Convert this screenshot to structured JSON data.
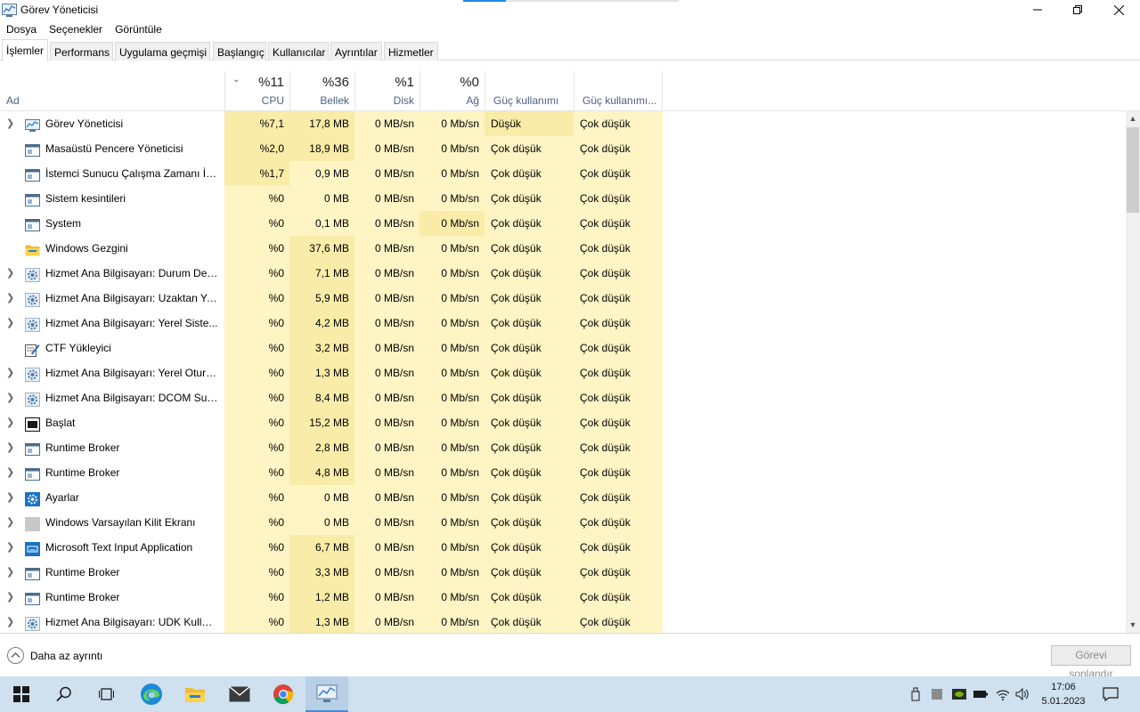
{
  "window": {
    "title": "Görev Yöneticisi"
  },
  "menu": [
    "Dosya",
    "Seçenekler",
    "Görüntüle"
  ],
  "tabs": [
    "İşlemler",
    "Performans",
    "Uygulama geçmişi",
    "Başlangıç",
    "Kullanıcılar",
    "Ayrıntılar",
    "Hizmetler"
  ],
  "columns": {
    "name": "Ad",
    "cpu": {
      "pct": "%11",
      "label": "CPU"
    },
    "memory": {
      "pct": "%36",
      "label": "Bellek"
    },
    "disk": {
      "pct": "%1",
      "label": "Disk"
    },
    "network": {
      "pct": "%0",
      "label": "Ağ"
    },
    "power": "Güç kullanımı",
    "power_trend": "Güç kullanımı..."
  },
  "processes": [
    {
      "name": "Görev Yöneticisi",
      "expand": true,
      "icon": "task-manager-icon",
      "cpu": "%7,1",
      "mem": "17,8 MB",
      "disk": "0 MB/sn",
      "net": "0 Mb/sn",
      "power": "Düşük",
      "trend": "Çok düşük"
    },
    {
      "name": "Masaüstü Pencere Yöneticisi",
      "expand": false,
      "icon": "window-app-icon",
      "cpu": "%2,0",
      "mem": "18,9 MB",
      "disk": "0 MB/sn",
      "net": "0 Mb/sn",
      "power": "Çok düşük",
      "trend": "Çok düşük"
    },
    {
      "name": "İstemci Sunucu Çalışma Zamanı İşl...",
      "expand": false,
      "icon": "window-app-icon",
      "cpu": "%1,7",
      "mem": "0,9 MB",
      "disk": "0 MB/sn",
      "net": "0 Mb/sn",
      "power": "Çok düşük",
      "trend": "Çok düşük"
    },
    {
      "name": "Sistem kesintileri",
      "expand": false,
      "icon": "window-app-icon",
      "cpu": "%0",
      "mem": "0 MB",
      "disk": "0 MB/sn",
      "net": "0 Mb/sn",
      "power": "Çok düşük",
      "trend": "Çok düşük"
    },
    {
      "name": "System",
      "expand": false,
      "icon": "window-app-icon",
      "cpu": "%0",
      "mem": "0,1 MB",
      "disk": "0 MB/sn",
      "net": "0 Mb/sn",
      "power": "Çok düşük",
      "trend": "Çok düşük"
    },
    {
      "name": "Windows Gezgini",
      "expand": false,
      "icon": "folder-icon",
      "cpu": "%0",
      "mem": "37,6 MB",
      "disk": "0 MB/sn",
      "net": "0 Mb/sn",
      "power": "Çok düşük",
      "trend": "Çok düşük"
    },
    {
      "name": "Hizmet Ana Bilgisayarı: Durum Dep...",
      "expand": true,
      "icon": "gear-icon",
      "cpu": "%0",
      "mem": "7,1 MB",
      "disk": "0 MB/sn",
      "net": "0 Mb/sn",
      "power": "Çok düşük",
      "trend": "Çok düşük"
    },
    {
      "name": "Hizmet Ana Bilgisayarı: Uzaktan Yo...",
      "expand": true,
      "icon": "gear-icon",
      "cpu": "%0",
      "mem": "5,9 MB",
      "disk": "0 MB/sn",
      "net": "0 Mb/sn",
      "power": "Çok düşük",
      "trend": "Çok düşük"
    },
    {
      "name": "Hizmet Ana Bilgisayarı: Yerel Siste...",
      "expand": true,
      "icon": "gear-icon",
      "cpu": "%0",
      "mem": "4,2 MB",
      "disk": "0 MB/sn",
      "net": "0 Mb/sn",
      "power": "Çok düşük",
      "trend": "Çok düşük"
    },
    {
      "name": "CTF Yükleyici",
      "expand": false,
      "icon": "pen-icon",
      "cpu": "%0",
      "mem": "3,2 MB",
      "disk": "0 MB/sn",
      "net": "0 Mb/sn",
      "power": "Çok düşük",
      "trend": "Çok düşük"
    },
    {
      "name": "Hizmet Ana Bilgisayarı: Yerel Oturu...",
      "expand": true,
      "icon": "gear-icon",
      "cpu": "%0",
      "mem": "1,3 MB",
      "disk": "0 MB/sn",
      "net": "0 Mb/sn",
      "power": "Çok düşük",
      "trend": "Çok düşük"
    },
    {
      "name": "Hizmet Ana Bilgisayarı: DCOM Sun...",
      "expand": true,
      "icon": "gear-icon",
      "cpu": "%0",
      "mem": "8,4 MB",
      "disk": "0 MB/sn",
      "net": "0 Mb/sn",
      "power": "Çok düşük",
      "trend": "Çok düşük"
    },
    {
      "name": "Başlat",
      "expand": true,
      "icon": "start-app-icon",
      "cpu": "%0",
      "mem": "15,2 MB",
      "disk": "0 MB/sn",
      "net": "0 Mb/sn",
      "power": "Çok düşük",
      "trend": "Çok düşük"
    },
    {
      "name": "Runtime Broker",
      "expand": true,
      "icon": "window-app-icon",
      "cpu": "%0",
      "mem": "2,8 MB",
      "disk": "0 MB/sn",
      "net": "0 Mb/sn",
      "power": "Çok düşük",
      "trend": "Çok düşük"
    },
    {
      "name": "Runtime Broker",
      "expand": true,
      "icon": "window-app-icon",
      "cpu": "%0",
      "mem": "4,8 MB",
      "disk": "0 MB/sn",
      "net": "0 Mb/sn",
      "power": "Çok düşük",
      "trend": "Çok düşük"
    },
    {
      "name": "Ayarlar",
      "expand": true,
      "icon": "settings-icon",
      "cpu": "%0",
      "mem": "0 MB",
      "disk": "0 MB/sn",
      "net": "0 Mb/sn",
      "power": "Çok düşük",
      "trend": "Çok düşük"
    },
    {
      "name": "Windows Varsayılan Kilit Ekranı",
      "expand": true,
      "icon": "blank-app-icon",
      "cpu": "%0",
      "mem": "0 MB",
      "disk": "0 MB/sn",
      "net": "0 Mb/sn",
      "power": "Çok düşük",
      "trend": "Çok düşük"
    },
    {
      "name": "Microsoft Text Input Application",
      "expand": true,
      "icon": "keyboard-icon",
      "cpu": "%0",
      "mem": "6,7 MB",
      "disk": "0 MB/sn",
      "net": "0 Mb/sn",
      "power": "Çok düşük",
      "trend": "Çok düşük"
    },
    {
      "name": "Runtime Broker",
      "expand": true,
      "icon": "window-app-icon",
      "cpu": "%0",
      "mem": "3,3 MB",
      "disk": "0 MB/sn",
      "net": "0 Mb/sn",
      "power": "Çok düşük",
      "trend": "Çok düşük"
    },
    {
      "name": "Runtime Broker",
      "expand": true,
      "icon": "window-app-icon",
      "cpu": "%0",
      "mem": "1,2 MB",
      "disk": "0 MB/sn",
      "net": "0 Mb/sn",
      "power": "Çok düşük",
      "trend": "Çok düşük"
    },
    {
      "name": "Hizmet Ana Bilgisayarı: UDK Kullan...",
      "expand": true,
      "icon": "gear-icon",
      "cpu": "%0",
      "mem": "1,3 MB",
      "disk": "0 MB/sn",
      "net": "0 Mb/sn",
      "power": "Çok düşük",
      "trend": "Çok düşük"
    }
  ],
  "footer": {
    "less_details": "Daha az ayrıntı",
    "end_task": "Görevi sonlandır"
  },
  "taskbar": {
    "apps": [
      "start-icon",
      "search-icon",
      "task-view-icon",
      "edge-icon",
      "file-explorer-icon",
      "mail-icon",
      "chrome-icon",
      "task-manager-icon"
    ],
    "time": "17:06",
    "date": "5.01.2023"
  },
  "colors": {
    "heat_light": "#fff4c4",
    "heat_medium": "#f9eca8",
    "heat_strong": "#ffe998",
    "header_label": "#4d6082",
    "taskbar": "#cfe0ef"
  }
}
